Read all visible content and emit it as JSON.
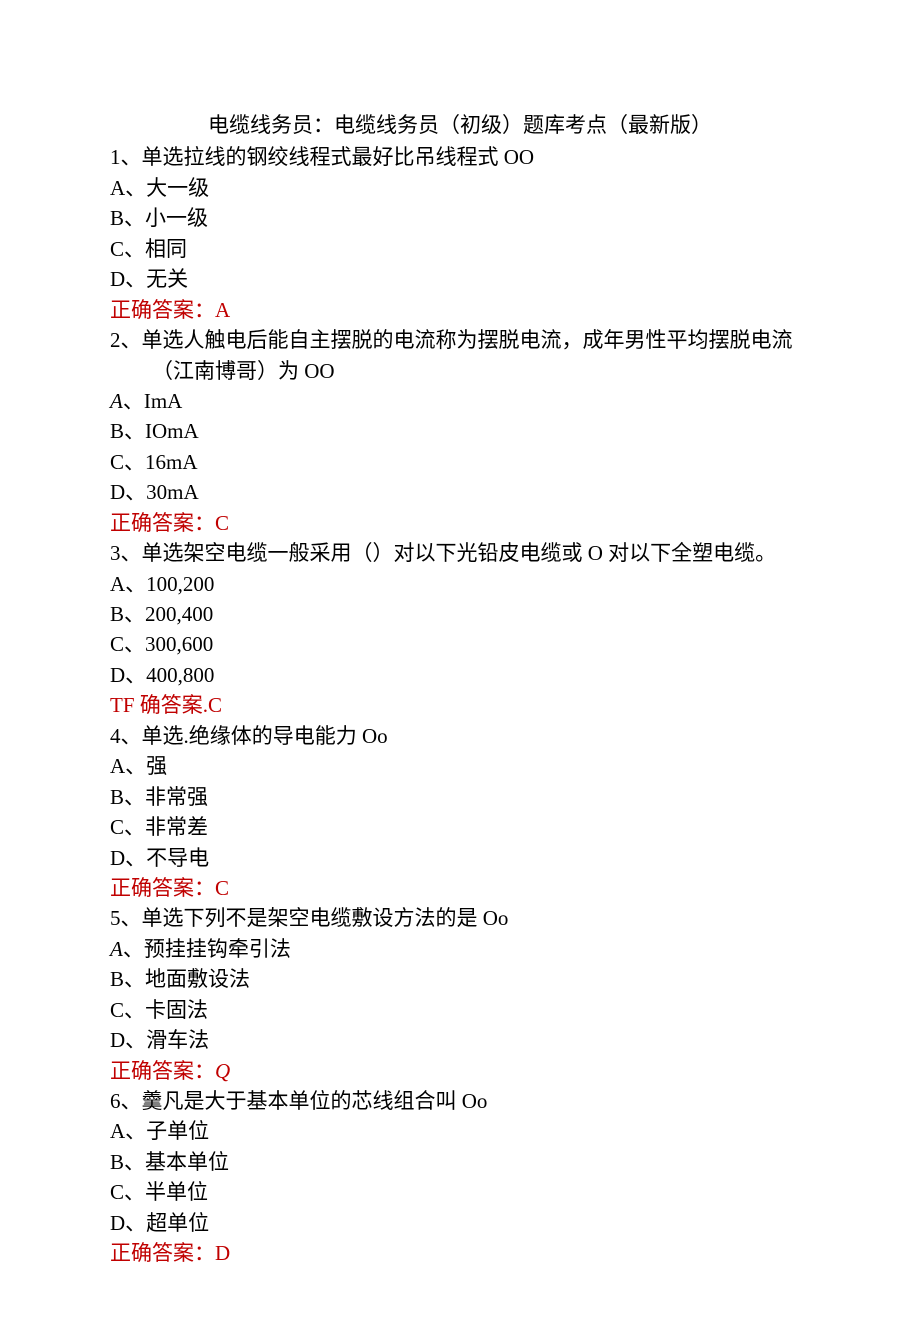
{
  "title": "电缆线务员：电缆线务员（初级）题库考点（最新版）",
  "questions": [
    {
      "stem": "1、单选拉线的钢绞线程式最好比吊线程式 OO",
      "options": [
        {
          "label": "A、大一级",
          "italic": false
        },
        {
          "label": "B、小一级",
          "italic": false
        },
        {
          "label": "C、相同",
          "italic": false
        },
        {
          "label": "D、无关",
          "italic": false
        }
      ],
      "answerPrefix": "正确答案：",
      "answerValue": "A",
      "answerItalic": false,
      "answerFullLine": ""
    },
    {
      "stem": "2、单选人触电后能自主摆脱的电流称为摆脱电流，成年男性平均摆脱电流",
      "stemLine2": "（江南博哥）为 OO",
      "options": [
        {
          "label": "A、ImA",
          "italic": true,
          "prefix": "A",
          "rest": "、ImA"
        },
        {
          "label": "B、IOmA",
          "italic": false
        },
        {
          "label": "C、16mA",
          "italic": false
        },
        {
          "label": "D、30mA",
          "italic": false
        }
      ],
      "answerPrefix": "正确答案：",
      "answerValue": "C",
      "answerItalic": false,
      "answerFullLine": ""
    },
    {
      "stem": "3、单选架空电缆一般采用（）对以下光铅皮电缆或 O 对以下全塑电缆。",
      "options": [
        {
          "label": "A、100,200",
          "italic": false
        },
        {
          "label": "B、200,400",
          "italic": false
        },
        {
          "label": "C、300,600",
          "italic": false
        },
        {
          "label": "D、400,800",
          "italic": false
        }
      ],
      "answerPrefix": "",
      "answerValue": "",
      "answerItalic": false,
      "answerFullLine": "TF 确答案.C"
    },
    {
      "stem": "4、单选.绝缘体的导电能力 Oo",
      "options": [
        {
          "label": "A、强",
          "italic": false
        },
        {
          "label": "B、非常强",
          "italic": false
        },
        {
          "label": "C、非常差",
          "italic": false
        },
        {
          "label": "D、不导电",
          "italic": false
        }
      ],
      "answerPrefix": "正确答案：",
      "answerValue": "C",
      "answerItalic": false,
      "answerFullLine": ""
    },
    {
      "stem": "5、单选下列不是架空电缆敷设方法的是 Oo",
      "options": [
        {
          "label": "A、预挂挂钩牵引法",
          "italic": true,
          "prefix": "A",
          "rest": "、预挂挂钩牵引法"
        },
        {
          "label": "B、地面敷设法",
          "italic": false
        },
        {
          "label": "C、卡固法",
          "italic": false
        },
        {
          "label": "D、滑车法",
          "italic": false
        }
      ],
      "answerPrefix": "正确答案：",
      "answerValue": "Q",
      "answerItalic": true,
      "answerFullLine": ""
    },
    {
      "stem": "6、羹凡是大于基本单位的芯线组合叫 Oo",
      "options": [
        {
          "label": "A、子单位",
          "italic": false
        },
        {
          "label": "B、基本单位",
          "italic": false
        },
        {
          "label": "C、半单位",
          "italic": false
        },
        {
          "label": "D、超单位",
          "italic": false
        }
      ],
      "answerPrefix": "正确答案：",
      "answerValue": "D",
      "answerItalic": false,
      "answerFullLine": ""
    }
  ]
}
